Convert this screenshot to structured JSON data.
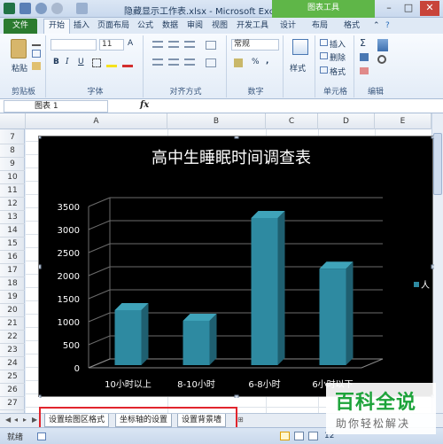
{
  "window": {
    "title": "隐藏显示工作表.xlsx - Microsoft Excel",
    "chart_tools_label": "图表工具",
    "min_label": "–",
    "restore_label": "□",
    "close_label": "✕"
  },
  "tabs": {
    "file": "文件",
    "home": "开始",
    "insert": "插入",
    "layout": "页面布局",
    "formula": "公式",
    "data": "数据",
    "review": "审阅",
    "view": "视图",
    "developer": "开发工具",
    "design": "设计",
    "chart_layout": "布局",
    "format": "格式"
  },
  "ribbon": {
    "clipboard": {
      "label": "剪贴板",
      "paste": "粘贴"
    },
    "font": {
      "label": "字体",
      "size": "11",
      "bold": "B",
      "italic": "I",
      "underline": "U"
    },
    "alignment": {
      "label": "对齐方式"
    },
    "number": {
      "label": "数字",
      "format": "常规",
      "percent": "%",
      "comma": ","
    },
    "styles": {
      "label": "样式"
    },
    "cells": {
      "label": "单元格",
      "insert": "插入",
      "delete": "删除",
      "format": "格式"
    },
    "editing": {
      "label": "编辑",
      "sigma": "Σ"
    }
  },
  "formula_bar": {
    "name_box": "图表 1",
    "fx": "fx"
  },
  "grid": {
    "columns": [
      "A",
      "B",
      "C",
      "D",
      "E"
    ],
    "rows": [
      "7",
      "8",
      "9",
      "10",
      "11",
      "12",
      "13",
      "14",
      "15",
      "16",
      "17",
      "18",
      "19",
      "20",
      "21",
      "22",
      "23",
      "24",
      "25",
      "26",
      "27"
    ]
  },
  "chart_data": {
    "type": "bar",
    "title": "高中生睡眠时间调查表",
    "categories": [
      "10小时以上",
      "8-10小时",
      "6-8小时",
      "6小时以下"
    ],
    "series": [
      {
        "values": [
          1250,
          1020,
          3250,
          2150
        ]
      }
    ],
    "legend_text": "人",
    "ylim": [
      0,
      3500
    ],
    "yticks": [
      "0",
      "500",
      "1000",
      "1500",
      "2000",
      "2500",
      "3000",
      "3500"
    ],
    "grid": true,
    "legend": "right",
    "bar_color": "#2e8aa1",
    "background": "#000000"
  },
  "sheet_tabs": [
    "设置绘图区格式",
    "坐标轴的设置",
    "设置背景墙"
  ],
  "status": {
    "ready": "就绪",
    "zoom": "12"
  },
  "watermark": {
    "title": "百科全说",
    "subtitle": "助你轻松解决"
  }
}
